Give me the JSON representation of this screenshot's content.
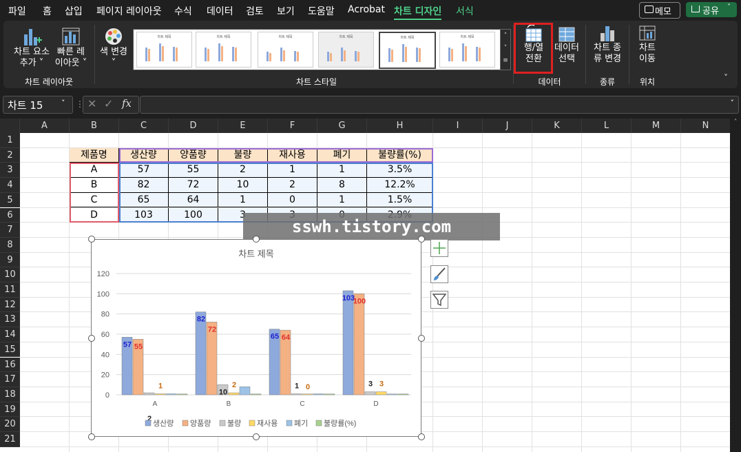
{
  "menu": {
    "tabs": [
      "파일",
      "홈",
      "삽입",
      "페이지 레이아웃",
      "수식",
      "데이터",
      "검토",
      "보기",
      "도움말",
      "Acrobat",
      "차트 디자인",
      "서식"
    ],
    "memo": "메모",
    "share": "공유"
  },
  "ribbon": {
    "add_element": [
      "차트 요소",
      "추가 ˅"
    ],
    "quick_layout": [
      "빠른 레",
      "이아웃 ˅"
    ],
    "group_layout": "차트 레이아웃",
    "change_color": "색 변경",
    "group_styles": "차트 스타일",
    "switch_row_col": [
      "행/열",
      "전환"
    ],
    "select_data": [
      "데이터",
      "선택"
    ],
    "group_data": "데이터",
    "change_type": [
      "차트 종",
      "류 변경"
    ],
    "group_type": "종류",
    "move_chart": [
      "차트",
      "이동"
    ],
    "group_location": "위치",
    "thumb_title": "차트 제목"
  },
  "formula_bar": {
    "name_box": "차트 15",
    "fx": "fx",
    "formula": ""
  },
  "columns": [
    "A",
    "B",
    "C",
    "D",
    "E",
    "F",
    "G",
    "H",
    "I",
    "J",
    "K",
    "L",
    "M",
    "N"
  ],
  "rows": [
    "1",
    "2",
    "3",
    "4",
    "5",
    "6",
    "7",
    "8",
    "9",
    "10",
    "11",
    "12",
    "13",
    "14",
    "15",
    "16",
    "17",
    "18",
    "19",
    "20",
    "21"
  ],
  "table": {
    "headers": [
      "제품명",
      "생산량",
      "양품량",
      "불량",
      "재사용",
      "폐기",
      "불량률(%)"
    ],
    "rows": [
      [
        "A",
        "57",
        "55",
        "2",
        "1",
        "1",
        "3.5%"
      ],
      [
        "B",
        "82",
        "72",
        "10",
        "2",
        "8",
        "12.2%"
      ],
      [
        "C",
        "65",
        "64",
        "1",
        "0",
        "1",
        "1.5%"
      ],
      [
        "D",
        "103",
        "100",
        "3",
        "3",
        "0",
        "2.9%"
      ]
    ]
  },
  "watermark": "sswh.tistory.com",
  "colors": {
    "accent": "#4fd18b",
    "highlight": "#e02020",
    "series": [
      "#8ea9db",
      "#f4b183",
      "#c9c9c9",
      "#ffd966",
      "#9dc3e6",
      "#a9d18e"
    ]
  },
  "chart_data": {
    "type": "bar",
    "title": "차트 제목",
    "categories": [
      "A",
      "B",
      "C",
      "D"
    ],
    "ylim": [
      0,
      120
    ],
    "yticks": [
      0,
      20,
      40,
      60,
      80,
      100,
      120
    ],
    "grid": true,
    "legend_position": "bottom",
    "series": [
      {
        "name": "생산량",
        "values": [
          57,
          82,
          65,
          103
        ],
        "label_color": "#1f1fd0"
      },
      {
        "name": "양품량",
        "values": [
          55,
          72,
          64,
          100
        ],
        "label_color": "#e03030"
      },
      {
        "name": "불량",
        "values": [
          2,
          10,
          1,
          3
        ],
        "label_color": "#222222"
      },
      {
        "name": "재사용",
        "values": [
          1,
          2,
          0,
          3
        ],
        "label_color": "#c86a10"
      },
      {
        "name": "폐기",
        "values": [
          1,
          8,
          1,
          0
        ],
        "label_color": ""
      },
      {
        "name": "불량률(%)",
        "values": [
          0.035,
          0.122,
          0.015,
          0.029
        ],
        "label_color": ""
      }
    ],
    "data_labels": [
      {
        "series": 0,
        "cat": 0,
        "text": "57"
      },
      {
        "series": 1,
        "cat": 0,
        "text": "55"
      },
      {
        "series": 2,
        "cat": 0,
        "text": "2"
      },
      {
        "series": 3,
        "cat": 0,
        "text": "1"
      },
      {
        "series": 0,
        "cat": 1,
        "text": "82"
      },
      {
        "series": 1,
        "cat": 1,
        "text": "72"
      },
      {
        "series": 2,
        "cat": 1,
        "text": "10"
      },
      {
        "series": 3,
        "cat": 1,
        "text": "2"
      },
      {
        "series": 0,
        "cat": 2,
        "text": "65"
      },
      {
        "series": 1,
        "cat": 2,
        "text": "64"
      },
      {
        "series": 2,
        "cat": 2,
        "text": "1"
      },
      {
        "series": 3,
        "cat": 2,
        "text": "0"
      },
      {
        "series": 0,
        "cat": 3,
        "text": "103"
      },
      {
        "series": 1,
        "cat": 3,
        "text": "100"
      },
      {
        "series": 2,
        "cat": 3,
        "text": "3"
      },
      {
        "series": 3,
        "cat": 3,
        "text": "3"
      }
    ]
  }
}
